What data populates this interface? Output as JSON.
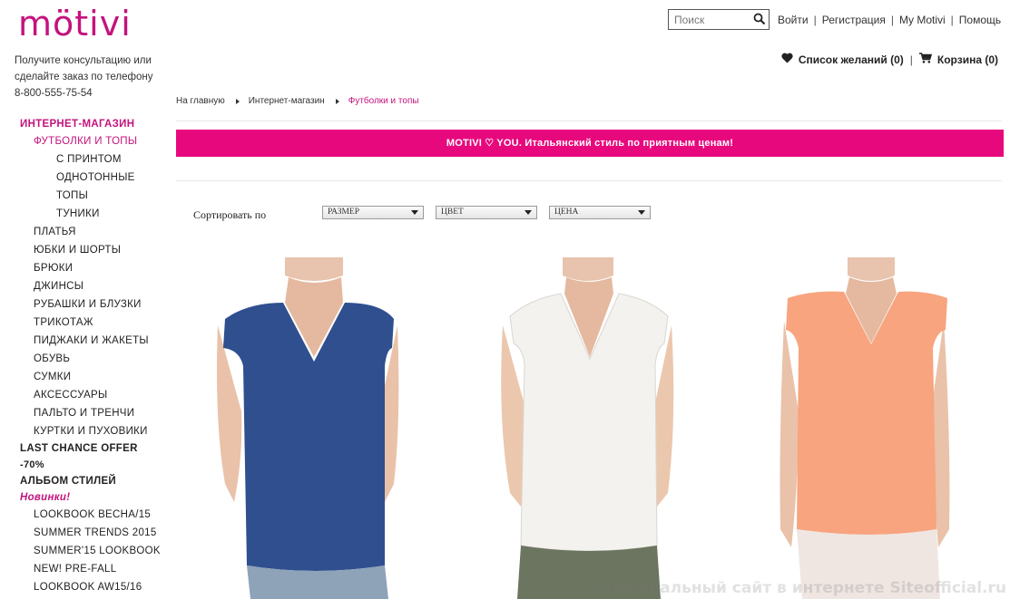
{
  "brand": {
    "logo_text": "mötivi",
    "accent_color": "#c4137d",
    "banner_color": "#e8087d"
  },
  "header": {
    "search_placeholder": "Поиск",
    "links": [
      "Войти",
      "Регистрация",
      "My Motivi",
      "Помощь"
    ],
    "wishlist_label": "Список желаний (0)",
    "cart_label": "Корзина (0)"
  },
  "consult": {
    "line1": "Получите консультацию или",
    "line2": "сделайте заказ по телефону",
    "phone": "8-800-555-75-54"
  },
  "sidebar": {
    "items": [
      "ИНТЕРНЕТ-МАГАЗИН",
      "ФУТБОЛКИ И ТОПЫ",
      "С ПРИНТОМ",
      "ОДНОТОННЫЕ",
      "ТОПЫ",
      "ТУНИКИ",
      "ПЛАТЬЯ",
      "ЮБКИ И ШОРТЫ",
      "БРЮКИ",
      "ДЖИНСЫ",
      "РУБАШКИ И БЛУЗКИ",
      "ТРИКОТАЖ",
      "ПИДЖАКИ И ЖАКЕТЫ",
      "ОБУВЬ",
      "СУМКИ",
      "АКСЕССУАРЫ",
      "ПАЛЬТО И ТРЕНЧИ",
      "КУРТКИ И ПУХОВИКИ",
      "LAST CHANCE OFFER",
      "-70%",
      "АЛЬБОМ СТИЛЕЙ",
      "Новинки!",
      "LOOKBOOK ВЕСНА/15",
      "SUMMER TRENDS 2015",
      "SUMMER'15 LOOKBOOK",
      "NEW! PRE-FALL",
      "LOOKBOOK AW15/16"
    ]
  },
  "breadcrumb": {
    "home": "На главную",
    "shop": "Интернет-магазин",
    "current": "Футболки и топы"
  },
  "banner": {
    "text": "MOTIVI ♡ YOU. Итальянский стиль по приятным ценам!"
  },
  "sorting": {
    "label": "Сортировать по",
    "selects": [
      "РАЗМЕР",
      "ЦВЕТ",
      "ЦЕНА"
    ]
  },
  "products": [
    {
      "color": "#2f4f8f"
    },
    {
      "color": "#f4f2ee"
    },
    {
      "color": "#f7a47f"
    }
  ],
  "watermark": "Официальный сайт в интернете Siteofficial.ru"
}
